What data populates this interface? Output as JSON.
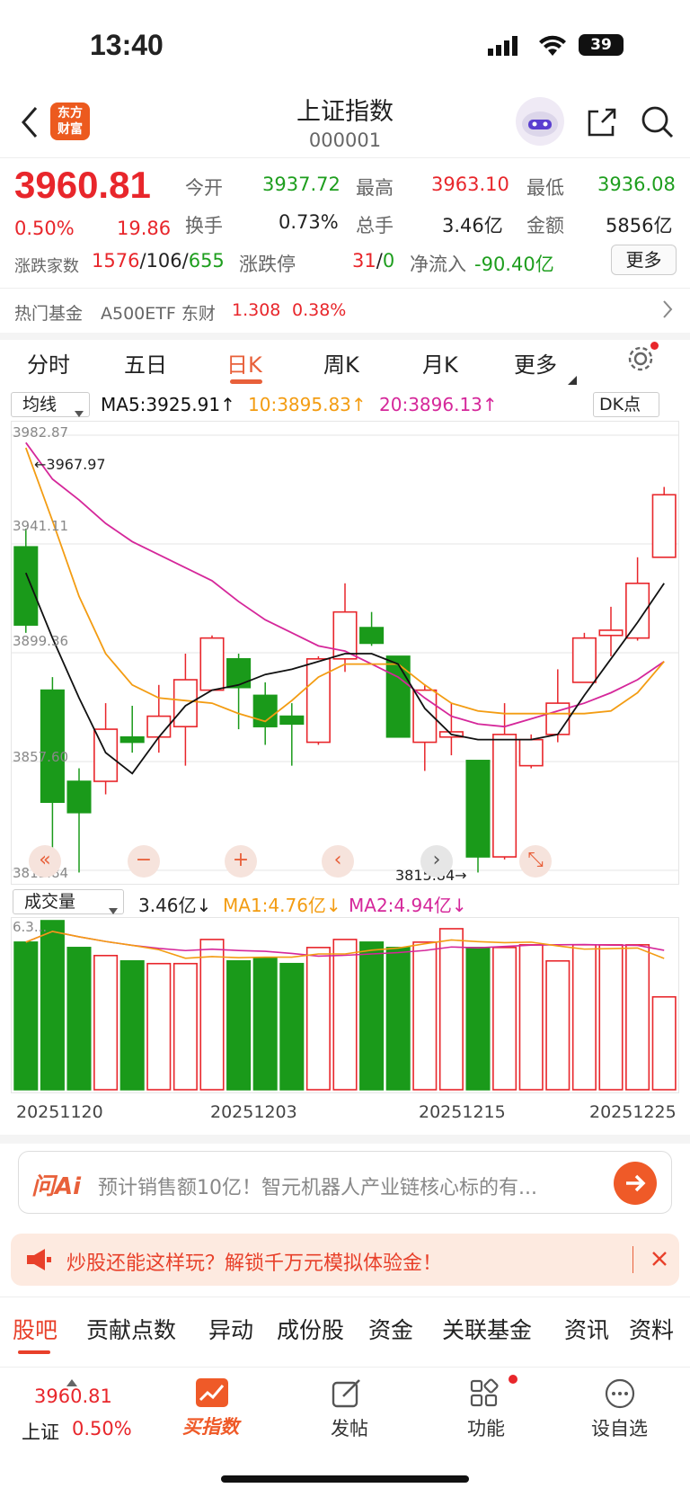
{
  "status": {
    "time": "13:40",
    "battery": "39"
  },
  "header": {
    "title": "上证指数",
    "code": "000001",
    "logo_line1": "东方",
    "logo_line2": "财富"
  },
  "quote": {
    "price": "3960.81",
    "change_pct": "0.50%",
    "change": "19.86",
    "open_label": "今开",
    "open": "3937.72",
    "high_label": "最高",
    "high": "3963.10",
    "low_label": "最低",
    "low": "3936.08",
    "turnover_label": "换手",
    "turnover": "0.73%",
    "volume_label": "总手",
    "volume": "3.46亿",
    "amount_label": "金额",
    "amount": "5856亿",
    "breadth_label": "涨跌家数",
    "up": "1576",
    "flat": "106",
    "down": "655",
    "limit_label": "涨跌停",
    "limit_up": "31",
    "limit_down": "0",
    "netflow_label": "净流入",
    "netflow": "-90.40亿",
    "more_button": "更多"
  },
  "hot_fund": {
    "label": "热门基金",
    "name": "A500ETF 东财",
    "price": "1.308",
    "pct": "0.38%"
  },
  "period_tabs": [
    "分时",
    "五日",
    "日K",
    "周K",
    "月K",
    "更多"
  ],
  "active_tab": "日K",
  "ma_legend": {
    "selector": "均线",
    "ma5": "MA5:3925.91↑",
    "ma10": "10:3895.83↑",
    "ma20": "20:3896.13↑",
    "dk": "DK点"
  },
  "y_labels": [
    "3982.87",
    "3941.11",
    "3899.36",
    "3857.60",
    "3815.84"
  ],
  "annotations": {
    "max": "←3967.97",
    "min": "3815.84→"
  },
  "volume_legend": {
    "selector": "成交量",
    "vol": "3.46亿↓",
    "ma1": "MA1:4.76亿↓",
    "ma2": "MA2:4.94亿↓",
    "top": "6.3..."
  },
  "dates": [
    "20251120",
    "20251203",
    "20251215",
    "20251225"
  ],
  "chart_data": {
    "type": "candlestick",
    "ylim": [
      3815.84,
      3982.87
    ],
    "candles": [
      {
        "o": 3940,
        "c": 3910,
        "h": 3947,
        "l": 3907
      },
      {
        "o": 3885,
        "c": 3842,
        "h": 3890,
        "l": 3822
      },
      {
        "o": 3850,
        "c": 3838,
        "h": 3855,
        "l": 3815
      },
      {
        "o": 3850,
        "c": 3870,
        "h": 3880,
        "l": 3845
      },
      {
        "o": 3867,
        "c": 3865,
        "h": 3879,
        "l": 3861
      },
      {
        "o": 3867,
        "c": 3875,
        "h": 3887,
        "l": 3861
      },
      {
        "o": 3871,
        "c": 3889,
        "h": 3899,
        "l": 3856
      },
      {
        "o": 3885,
        "c": 3905,
        "h": 3906,
        "l": 3885
      },
      {
        "o": 3897,
        "c": 3886,
        "h": 3899,
        "l": 3870
      },
      {
        "o": 3883,
        "c": 3871,
        "h": 3888,
        "l": 3864
      },
      {
        "o": 3875,
        "c": 3872,
        "h": 3880,
        "l": 3856
      },
      {
        "o": 3865,
        "c": 3897,
        "h": 3898,
        "l": 3864
      },
      {
        "o": 3897,
        "c": 3915,
        "h": 3926,
        "l": 3892
      },
      {
        "o": 3909,
        "c": 3903,
        "h": 3915,
        "l": 3902
      },
      {
        "o": 3898,
        "c": 3867,
        "h": 3898,
        "l": 3870
      },
      {
        "o": 3865,
        "c": 3885,
        "h": 3887,
        "l": 3854
      },
      {
        "o": 3867,
        "c": 3869,
        "h": 3880,
        "l": 3860
      },
      {
        "o": 3858,
        "c": 3821,
        "h": 3858,
        "l": 3815
      },
      {
        "o": 3821,
        "c": 3868,
        "h": 3880,
        "l": 3820
      },
      {
        "o": 3856,
        "c": 3866,
        "h": 3868,
        "l": 3855
      },
      {
        "o": 3868,
        "c": 3880,
        "h": 3893,
        "l": 3865
      },
      {
        "o": 3888,
        "c": 3905,
        "h": 3907,
        "l": 3888
      },
      {
        "o": 3906,
        "c": 3908,
        "h": 3917,
        "l": 3898
      },
      {
        "o": 3905,
        "c": 3926,
        "h": 3936,
        "l": 3904
      },
      {
        "o": 3936,
        "c": 3960,
        "h": 3963,
        "l": 3936
      }
    ],
    "ma5": [
      3930,
      3905,
      3882,
      3861,
      3853,
      3867,
      3879,
      3885,
      3887,
      3891,
      3893,
      3896,
      3899,
      3899,
      3895,
      3878,
      3868,
      3866,
      3866,
      3866,
      3868,
      3883,
      3897,
      3911,
      3926
    ],
    "ma10": [
      3978,
      3950,
      3921,
      3899,
      3887,
      3882,
      3881,
      3880,
      3876,
      3873,
      3881,
      3890,
      3895,
      3895,
      3895,
      3887,
      3880,
      3877,
      3876,
      3876,
      3876,
      3876,
      3877,
      3884,
      3896
    ],
    "ma20": [
      3980,
      3966,
      3958,
      3949,
      3942,
      3937,
      3932,
      3927,
      3919,
      3912,
      3907,
      3902,
      3900,
      3895,
      3890,
      3882,
      3875,
      3872,
      3871,
      3874,
      3877,
      3880,
      3884,
      3889,
      3896
    ],
    "volume_ylim": [
      0,
      6.3
    ],
    "volumes": [
      5.5,
      6.3,
      5.3,
      5.0,
      4.8,
      4.7,
      4.7,
      5.6,
      4.8,
      4.9,
      4.7,
      5.3,
      5.6,
      5.5,
      5.3,
      5.5,
      6.0,
      5.3,
      5.3,
      5.4,
      4.8,
      5.4,
      5.4,
      5.4,
      3.46
    ]
  },
  "ai_bar": {
    "brand": "问Ai",
    "text": "预计销售额10亿！智元机器人产业链核心标的有..."
  },
  "promo": {
    "text": "炒股还能这样玩？解锁千万元模拟体验金！"
  },
  "bottom_tabs": [
    "股吧",
    "贡献点数",
    "异动",
    "成份股",
    "资金",
    "关联基金",
    "资讯",
    "资料"
  ],
  "footer": {
    "index_price": "3960.81",
    "index_name": "上证",
    "index_pct": "0.50%",
    "buy_index": "买指数",
    "post": "发帖",
    "function": "功能",
    "watchlist": "设自选"
  }
}
